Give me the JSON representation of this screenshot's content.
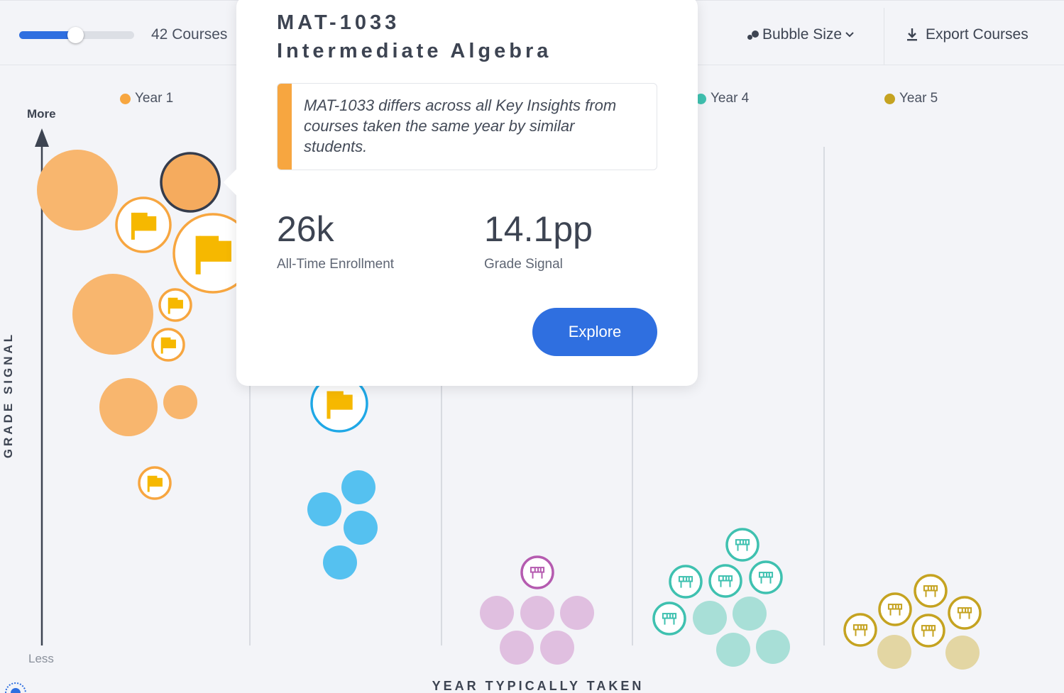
{
  "toolbar": {
    "course_count": "42 Courses",
    "slider_fraction": 0.49,
    "bubble_size_label": "Bubble Size",
    "export_label": "Export Courses"
  },
  "chart": {
    "y_axis_title": "GRADE SIGNAL",
    "y_axis_top": "More",
    "y_axis_bottom": "Less",
    "x_axis_title": "YEAR TYPICALLY TAKEN"
  },
  "legend": [
    {
      "label": "Year 1",
      "color": "#f7a640"
    },
    {
      "label": "Year 4",
      "color": "#3fc1b0"
    },
    {
      "label": "Year 5",
      "color": "#c5a321"
    }
  ],
  "colors": {
    "year1": "#f7a640",
    "year1_light": "#f8b66e",
    "year2": "#55c1f0",
    "year2_ring": "#1fa8e6",
    "year3": "#e0bfe0",
    "year3_ring": "#b55bb0",
    "year4": "#a8dfd7",
    "year4_ring": "#3fc1b0",
    "year5": "#e3d6a3",
    "year5_ring": "#c5a321",
    "flag": "#f6b800",
    "accent": "#2f6fe0"
  },
  "popover": {
    "course_code": "MAT-1033",
    "course_name": "Intermediate Algebra",
    "insight": "MAT-1033 differs across all Key Insights from courses taken the same year by similar students.",
    "enrollment_value": "26k",
    "enrollment_label": "All-Time Enrollment",
    "grade_signal_value": "14.1pp",
    "grade_signal_label": "Grade Signal",
    "explore_label": "Explore"
  }
}
